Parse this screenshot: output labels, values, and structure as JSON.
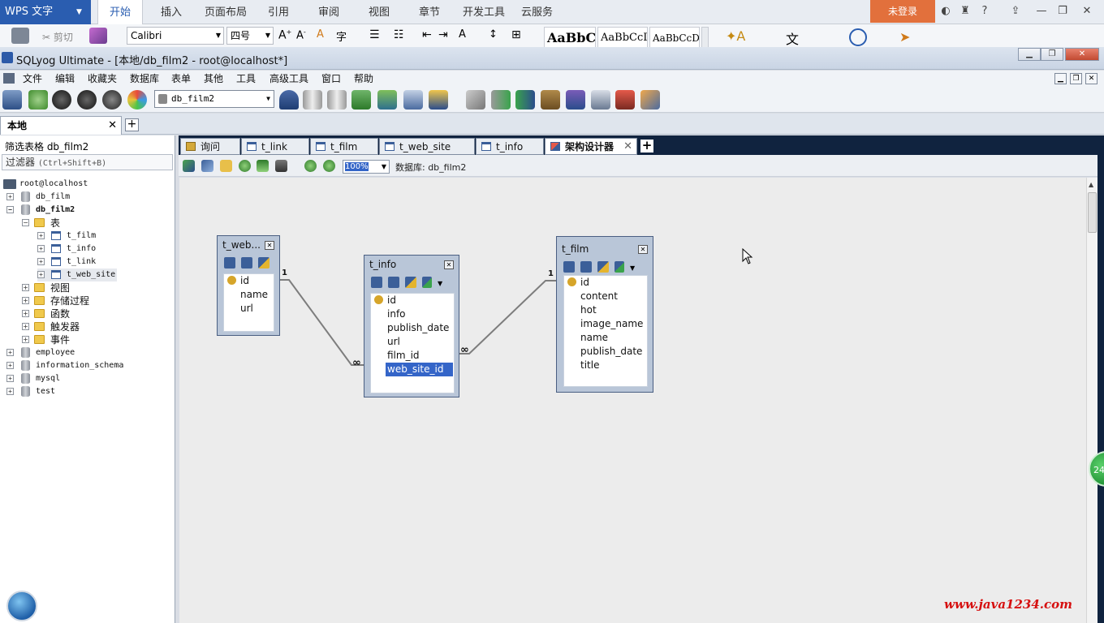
{
  "wps": {
    "logo": "WPS 文字",
    "tabs": [
      "开始",
      "插入",
      "页面布局",
      "引用",
      "审阅",
      "视图",
      "章节",
      "开发工具",
      "云服务"
    ],
    "login": "未登录",
    "font_name": "Calibri",
    "font_size": "四号",
    "cut_label": "剪切",
    "styles": [
      "AaBbC",
      "AaBbCcD",
      "AaBbCcDd"
    ]
  },
  "window": {
    "title": "SQLyog Ultimate - [本地/db_film2 - root@localhost*]"
  },
  "menu": [
    "文件",
    "编辑",
    "收藏夹",
    "数据库",
    "表单",
    "其他",
    "工具",
    "高级工具",
    "窗口",
    "帮助"
  ],
  "toolbar": {
    "db_select": "db_film2"
  },
  "connection_tab": {
    "label": "本地"
  },
  "left_panel": {
    "filter_label": "筛选表格 db_film2",
    "filter_input": "过滤器",
    "filter_hint": "(Ctrl+Shift+B)",
    "tree": {
      "server": "root@localhost",
      "db1": "db_film",
      "db2": "db_film2",
      "tables_folder": "表",
      "tables": [
        "t_film",
        "t_info",
        "t_link",
        "t_web_site"
      ],
      "folders": [
        "视图",
        "存储过程",
        "函数",
        "触发器",
        "事件"
      ],
      "others": [
        "employee",
        "information_schema",
        "mysql",
        "test"
      ]
    }
  },
  "doc_tabs": [
    "询问",
    "t_link",
    "t_film",
    "t_web_site",
    "t_info",
    "架构设计器"
  ],
  "designer": {
    "zoom": "100%",
    "db_label": "数据库: db_film2",
    "entities": {
      "web_site": {
        "title": "t_web...",
        "fields": [
          "id",
          "name",
          "url"
        ]
      },
      "info": {
        "title": "t_info",
        "fields": [
          "id",
          "info",
          "publish_date",
          "url",
          "film_id",
          "web_site_id"
        ]
      },
      "film": {
        "title": "t_film",
        "fields": [
          "id",
          "content",
          "hot",
          "image_name",
          "name",
          "publish_date",
          "title"
        ]
      }
    },
    "relations": {
      "one": "1",
      "many": "∞"
    }
  },
  "overlay": {
    "watermark": "www.java1234.com",
    "badge": "24"
  },
  "colors": {
    "wps_blue": "#2a5db0",
    "login_orange": "#e2703c",
    "selection": "#3465c8",
    "tab_strip": "#10233f"
  }
}
